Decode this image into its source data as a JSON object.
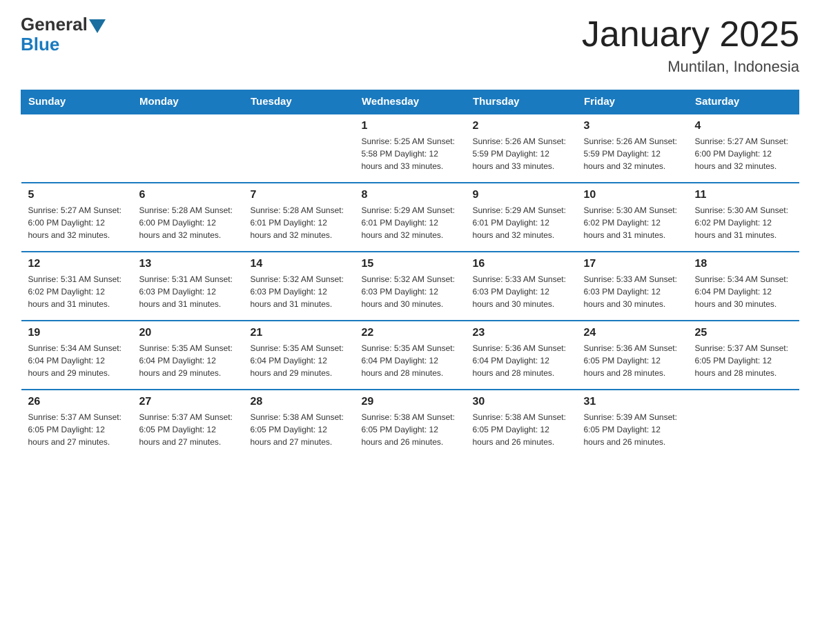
{
  "header": {
    "logo_general": "General",
    "logo_blue": "Blue",
    "title": "January 2025",
    "subtitle": "Muntilan, Indonesia"
  },
  "days_of_week": [
    "Sunday",
    "Monday",
    "Tuesday",
    "Wednesday",
    "Thursday",
    "Friday",
    "Saturday"
  ],
  "weeks": [
    [
      {
        "day": "",
        "info": ""
      },
      {
        "day": "",
        "info": ""
      },
      {
        "day": "",
        "info": ""
      },
      {
        "day": "1",
        "info": "Sunrise: 5:25 AM\nSunset: 5:58 PM\nDaylight: 12 hours\nand 33 minutes."
      },
      {
        "day": "2",
        "info": "Sunrise: 5:26 AM\nSunset: 5:59 PM\nDaylight: 12 hours\nand 33 minutes."
      },
      {
        "day": "3",
        "info": "Sunrise: 5:26 AM\nSunset: 5:59 PM\nDaylight: 12 hours\nand 32 minutes."
      },
      {
        "day": "4",
        "info": "Sunrise: 5:27 AM\nSunset: 6:00 PM\nDaylight: 12 hours\nand 32 minutes."
      }
    ],
    [
      {
        "day": "5",
        "info": "Sunrise: 5:27 AM\nSunset: 6:00 PM\nDaylight: 12 hours\nand 32 minutes."
      },
      {
        "day": "6",
        "info": "Sunrise: 5:28 AM\nSunset: 6:00 PM\nDaylight: 12 hours\nand 32 minutes."
      },
      {
        "day": "7",
        "info": "Sunrise: 5:28 AM\nSunset: 6:01 PM\nDaylight: 12 hours\nand 32 minutes."
      },
      {
        "day": "8",
        "info": "Sunrise: 5:29 AM\nSunset: 6:01 PM\nDaylight: 12 hours\nand 32 minutes."
      },
      {
        "day": "9",
        "info": "Sunrise: 5:29 AM\nSunset: 6:01 PM\nDaylight: 12 hours\nand 32 minutes."
      },
      {
        "day": "10",
        "info": "Sunrise: 5:30 AM\nSunset: 6:02 PM\nDaylight: 12 hours\nand 31 minutes."
      },
      {
        "day": "11",
        "info": "Sunrise: 5:30 AM\nSunset: 6:02 PM\nDaylight: 12 hours\nand 31 minutes."
      }
    ],
    [
      {
        "day": "12",
        "info": "Sunrise: 5:31 AM\nSunset: 6:02 PM\nDaylight: 12 hours\nand 31 minutes."
      },
      {
        "day": "13",
        "info": "Sunrise: 5:31 AM\nSunset: 6:03 PM\nDaylight: 12 hours\nand 31 minutes."
      },
      {
        "day": "14",
        "info": "Sunrise: 5:32 AM\nSunset: 6:03 PM\nDaylight: 12 hours\nand 31 minutes."
      },
      {
        "day": "15",
        "info": "Sunrise: 5:32 AM\nSunset: 6:03 PM\nDaylight: 12 hours\nand 30 minutes."
      },
      {
        "day": "16",
        "info": "Sunrise: 5:33 AM\nSunset: 6:03 PM\nDaylight: 12 hours\nand 30 minutes."
      },
      {
        "day": "17",
        "info": "Sunrise: 5:33 AM\nSunset: 6:03 PM\nDaylight: 12 hours\nand 30 minutes."
      },
      {
        "day": "18",
        "info": "Sunrise: 5:34 AM\nSunset: 6:04 PM\nDaylight: 12 hours\nand 30 minutes."
      }
    ],
    [
      {
        "day": "19",
        "info": "Sunrise: 5:34 AM\nSunset: 6:04 PM\nDaylight: 12 hours\nand 29 minutes."
      },
      {
        "day": "20",
        "info": "Sunrise: 5:35 AM\nSunset: 6:04 PM\nDaylight: 12 hours\nand 29 minutes."
      },
      {
        "day": "21",
        "info": "Sunrise: 5:35 AM\nSunset: 6:04 PM\nDaylight: 12 hours\nand 29 minutes."
      },
      {
        "day": "22",
        "info": "Sunrise: 5:35 AM\nSunset: 6:04 PM\nDaylight: 12 hours\nand 28 minutes."
      },
      {
        "day": "23",
        "info": "Sunrise: 5:36 AM\nSunset: 6:04 PM\nDaylight: 12 hours\nand 28 minutes."
      },
      {
        "day": "24",
        "info": "Sunrise: 5:36 AM\nSunset: 6:05 PM\nDaylight: 12 hours\nand 28 minutes."
      },
      {
        "day": "25",
        "info": "Sunrise: 5:37 AM\nSunset: 6:05 PM\nDaylight: 12 hours\nand 28 minutes."
      }
    ],
    [
      {
        "day": "26",
        "info": "Sunrise: 5:37 AM\nSunset: 6:05 PM\nDaylight: 12 hours\nand 27 minutes."
      },
      {
        "day": "27",
        "info": "Sunrise: 5:37 AM\nSunset: 6:05 PM\nDaylight: 12 hours\nand 27 minutes."
      },
      {
        "day": "28",
        "info": "Sunrise: 5:38 AM\nSunset: 6:05 PM\nDaylight: 12 hours\nand 27 minutes."
      },
      {
        "day": "29",
        "info": "Sunrise: 5:38 AM\nSunset: 6:05 PM\nDaylight: 12 hours\nand 26 minutes."
      },
      {
        "day": "30",
        "info": "Sunrise: 5:38 AM\nSunset: 6:05 PM\nDaylight: 12 hours\nand 26 minutes."
      },
      {
        "day": "31",
        "info": "Sunrise: 5:39 AM\nSunset: 6:05 PM\nDaylight: 12 hours\nand 26 minutes."
      },
      {
        "day": "",
        "info": ""
      }
    ]
  ]
}
